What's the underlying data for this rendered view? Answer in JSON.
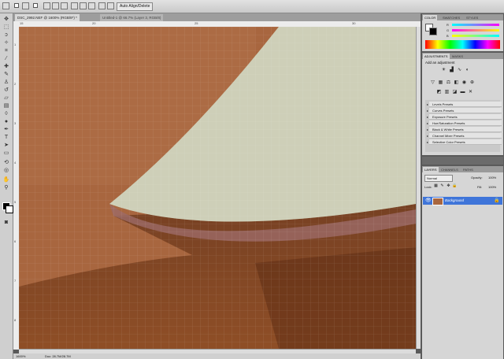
{
  "options_bar": {
    "auto_align_label": "Auto Align/Delete"
  },
  "tabs": [
    {
      "label": "DSC_2992.NEF @ 1600% (RGB/8*) *",
      "active": true
    },
    {
      "label": "Untitled-1 @ 66.7% (Layer 3, RGB/8)",
      "active": false
    }
  ],
  "rulers": {
    "top": [
      "15",
      "",
      "20",
      "",
      "25",
      "30"
    ],
    "left": [
      "1",
      "2",
      "3",
      "4",
      "5",
      "6",
      "7",
      "8",
      "9"
    ]
  },
  "status": {
    "zoom": "1600%",
    "doc": "Doc: 28.7M/28.7M"
  },
  "color_panel": {
    "tabs": [
      "COLOR",
      "SWATCHES",
      "STYLES"
    ],
    "channels": [
      "R",
      "G",
      "B"
    ],
    "values": [
      "",
      "",
      ""
    ]
  },
  "adjustments_panel": {
    "tabs": [
      "ADJUSTMENTS",
      "MASKS"
    ],
    "heading": "Add an adjustment",
    "presets": [
      "Levels Presets",
      "Curves Presets",
      "Exposure Presets",
      "Hue/Saturation Presets",
      "Black & White Presets",
      "Channel Mixer Presets",
      "Selective Color Presets"
    ]
  },
  "layers_panel": {
    "tabs": [
      "LAYERS",
      "CHANNELS",
      "PATHS"
    ],
    "blend_mode": "Normal",
    "opacity_label": "Opacity:",
    "opacity_value": "100%",
    "lock_label": "Lock:",
    "fill_label": "Fill:",
    "fill_value": "100%",
    "layer_name": "Background"
  },
  "colors": {
    "brown": "#a8663f",
    "dark_brown": "#7a3f1d",
    "mint": "#c8cab2",
    "selection_blue": "#3f75d9"
  }
}
